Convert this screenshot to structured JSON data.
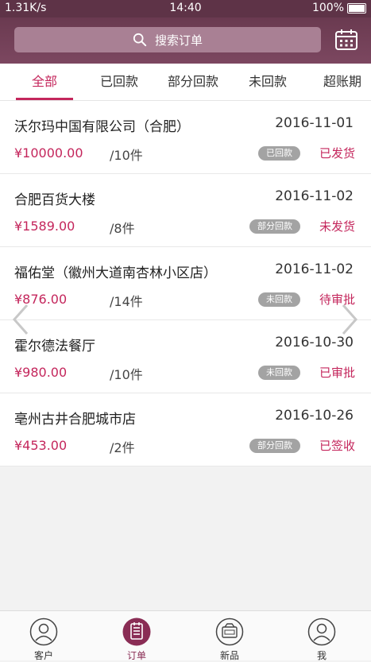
{
  "status_bar": {
    "speed": "1.31K/s",
    "time": "14:40",
    "battery": "100%"
  },
  "search": {
    "placeholder": "搜索订单"
  },
  "tabs": [
    {
      "label": "全部"
    },
    {
      "label": "已回款"
    },
    {
      "label": "部分回款"
    },
    {
      "label": "未回款"
    },
    {
      "label": "超账期"
    }
  ],
  "orders": [
    {
      "name": "沃尔玛中国有限公司（合肥）",
      "date": "2016-11-01",
      "amount": "¥10000.00",
      "qty": "/10件",
      "payment": "已回款",
      "status": "已发货"
    },
    {
      "name": "合肥百货大楼",
      "date": "2016-11-02",
      "amount": "¥1589.00",
      "qty": "/8件",
      "payment": "部分回款",
      "status": "未发货"
    },
    {
      "name": "福佑堂（徽州大道南杏林小区店）",
      "date": "2016-11-02",
      "amount": "¥876.00",
      "qty": "/14件",
      "payment": "未回款",
      "status": "待审批"
    },
    {
      "name": "霍尔德法餐厅",
      "date": "2016-10-30",
      "amount": "¥980.00",
      "qty": "/10件",
      "payment": "未回款",
      "status": "已审批"
    },
    {
      "name": "亳州古井合肥城市店",
      "date": "2016-10-26",
      "amount": "¥453.00",
      "qty": "/2件",
      "payment": "部分回款",
      "status": "已签收"
    }
  ],
  "bottom_nav": [
    {
      "label": "客户",
      "icon": "user-icon"
    },
    {
      "label": "订单",
      "icon": "order-list-icon"
    },
    {
      "label": "新品",
      "icon": "new-product-icon"
    },
    {
      "label": "我",
      "icon": "profile-icon"
    }
  ],
  "colors": {
    "header": "#6a3a50",
    "accent": "#c4265c",
    "badge": "#a3a3a3"
  }
}
